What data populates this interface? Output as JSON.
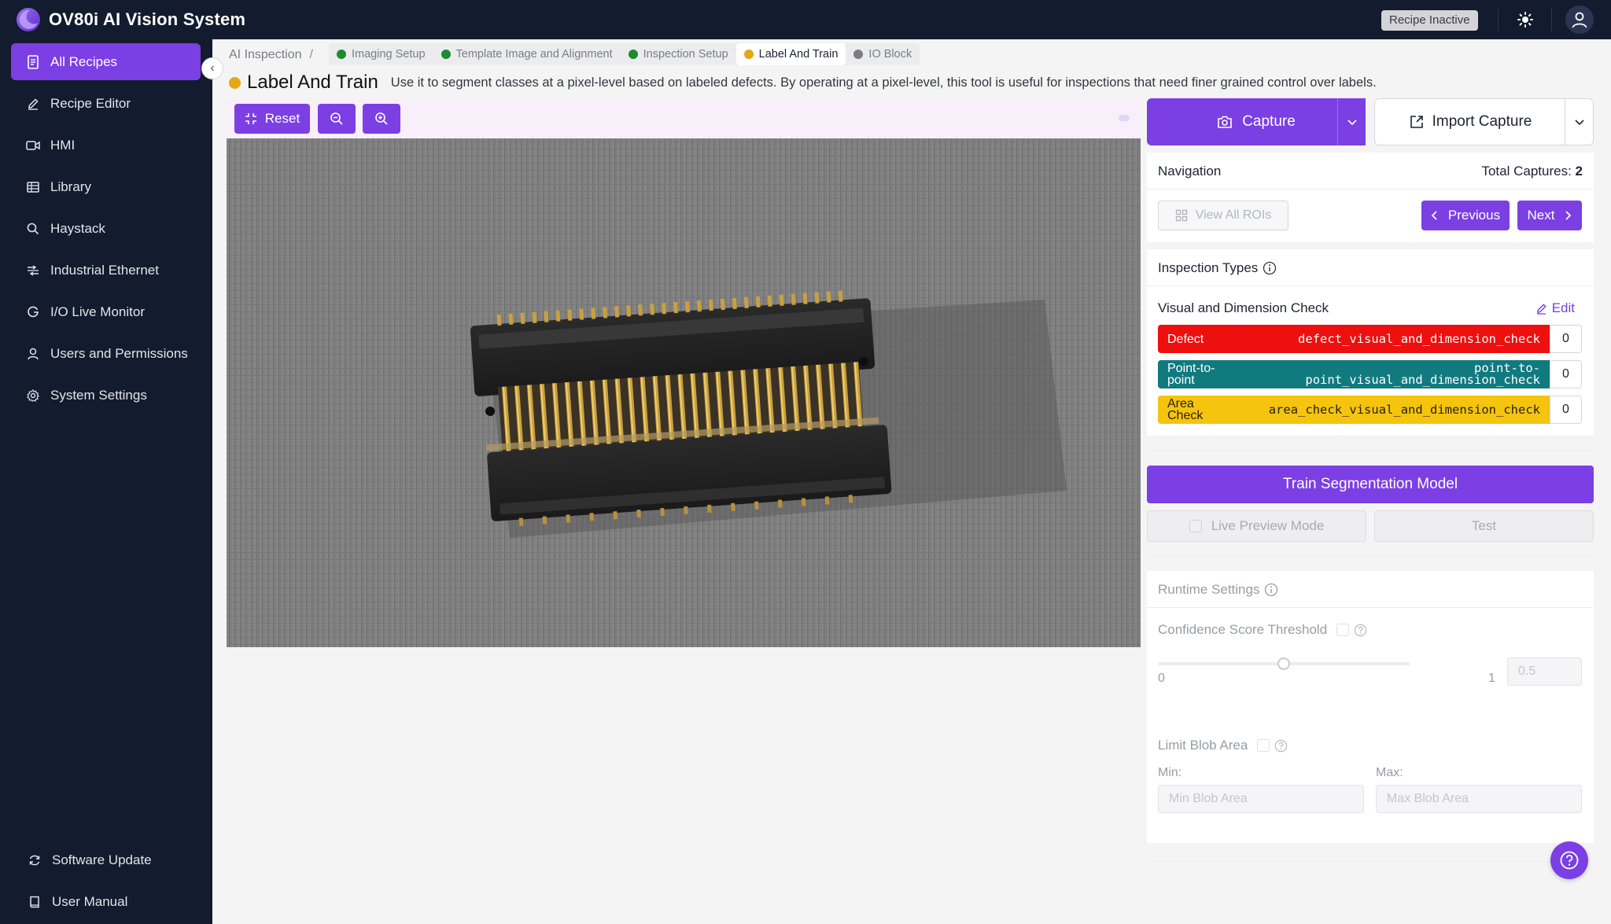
{
  "app": {
    "title": "OV80i AI Vision System",
    "recipe_status": "Recipe Inactive"
  },
  "sidebar": {
    "items": [
      {
        "label": "All Recipes",
        "icon": "document-icon",
        "active": true
      },
      {
        "label": "Recipe Editor",
        "icon": "pencil-icon"
      },
      {
        "label": "HMI",
        "icon": "video-icon"
      },
      {
        "label": "Library",
        "icon": "grid-icon"
      },
      {
        "label": "Haystack",
        "icon": "search-icon"
      },
      {
        "label": "Industrial Ethernet",
        "icon": "network-icon"
      },
      {
        "label": "I/O Live Monitor",
        "icon": "monitor-icon"
      },
      {
        "label": "Users and Permissions",
        "icon": "user-icon"
      },
      {
        "label": "System Settings",
        "icon": "gear-icon"
      }
    ],
    "bottom_items": [
      {
        "label": "Software Update",
        "icon": "refresh-icon"
      },
      {
        "label": "User Manual",
        "icon": "book-icon"
      }
    ]
  },
  "breadcrumb": {
    "root": "AI Inspection",
    "separator": "/",
    "steps": [
      {
        "label": "Imaging Setup",
        "status_color": "#1f8a2e"
      },
      {
        "label": "Template Image and Alignment",
        "status_color": "#1f8a2e"
      },
      {
        "label": "Inspection Setup",
        "status_color": "#1f8a2e"
      },
      {
        "label": "Label And Train",
        "status_color": "#e3a915",
        "current": true
      },
      {
        "label": "IO Block",
        "status_color": "#7d7d7d"
      }
    ]
  },
  "page": {
    "title": "Label And Train",
    "description": "Use it to segment classes at a pixel-level based on labeled defects. By operating at a pixel-level, this tool is useful for inspections that need finer grained control over labels."
  },
  "toolbar": {
    "reset_label": "Reset"
  },
  "capture": {
    "capture_label": "Capture",
    "import_label": "Import Capture"
  },
  "navigation": {
    "title": "Navigation",
    "total_label": "Total Captures:",
    "total_value": "2",
    "view_rois_label": "View All ROIs",
    "previous_label": "Previous",
    "next_label": "Next"
  },
  "inspection_types": {
    "title": "Inspection Types",
    "group_name": "Visual and Dimension Check",
    "edit_label": "Edit",
    "classes": [
      {
        "name": "Defect",
        "id": "defect_visual_and_dimension_check",
        "count": "0",
        "color": "#ee0f0f",
        "text_color": "#ffffff"
      },
      {
        "name": "Point-to-point",
        "id": "point-to-point_visual_and_dimension_check",
        "count": "0",
        "color": "#117a7f",
        "text_color": "#ffffff"
      },
      {
        "name": "Area Check",
        "id": "area_check_visual_and_dimension_check",
        "count": "0",
        "color": "#f5c40f",
        "text_color": "#2a2100"
      }
    ]
  },
  "train": {
    "train_label": "Train Segmentation Model",
    "live_preview_label": "Live Preview Mode",
    "test_label": "Test"
  },
  "runtime": {
    "title": "Runtime Settings",
    "confidence_label": "Confidence Score Threshold",
    "slider_min": "0",
    "slider_max": "1",
    "slider_value": 0.5,
    "threshold_value": "0.5",
    "limit_blob_label": "Limit Blob Area",
    "min_label": "Min:",
    "max_label": "Max:",
    "min_placeholder": "Min Blob Area",
    "max_placeholder": "Max Blob Area"
  },
  "colors": {
    "accent": "#7b3fe4",
    "topbar": "#131b2e"
  }
}
